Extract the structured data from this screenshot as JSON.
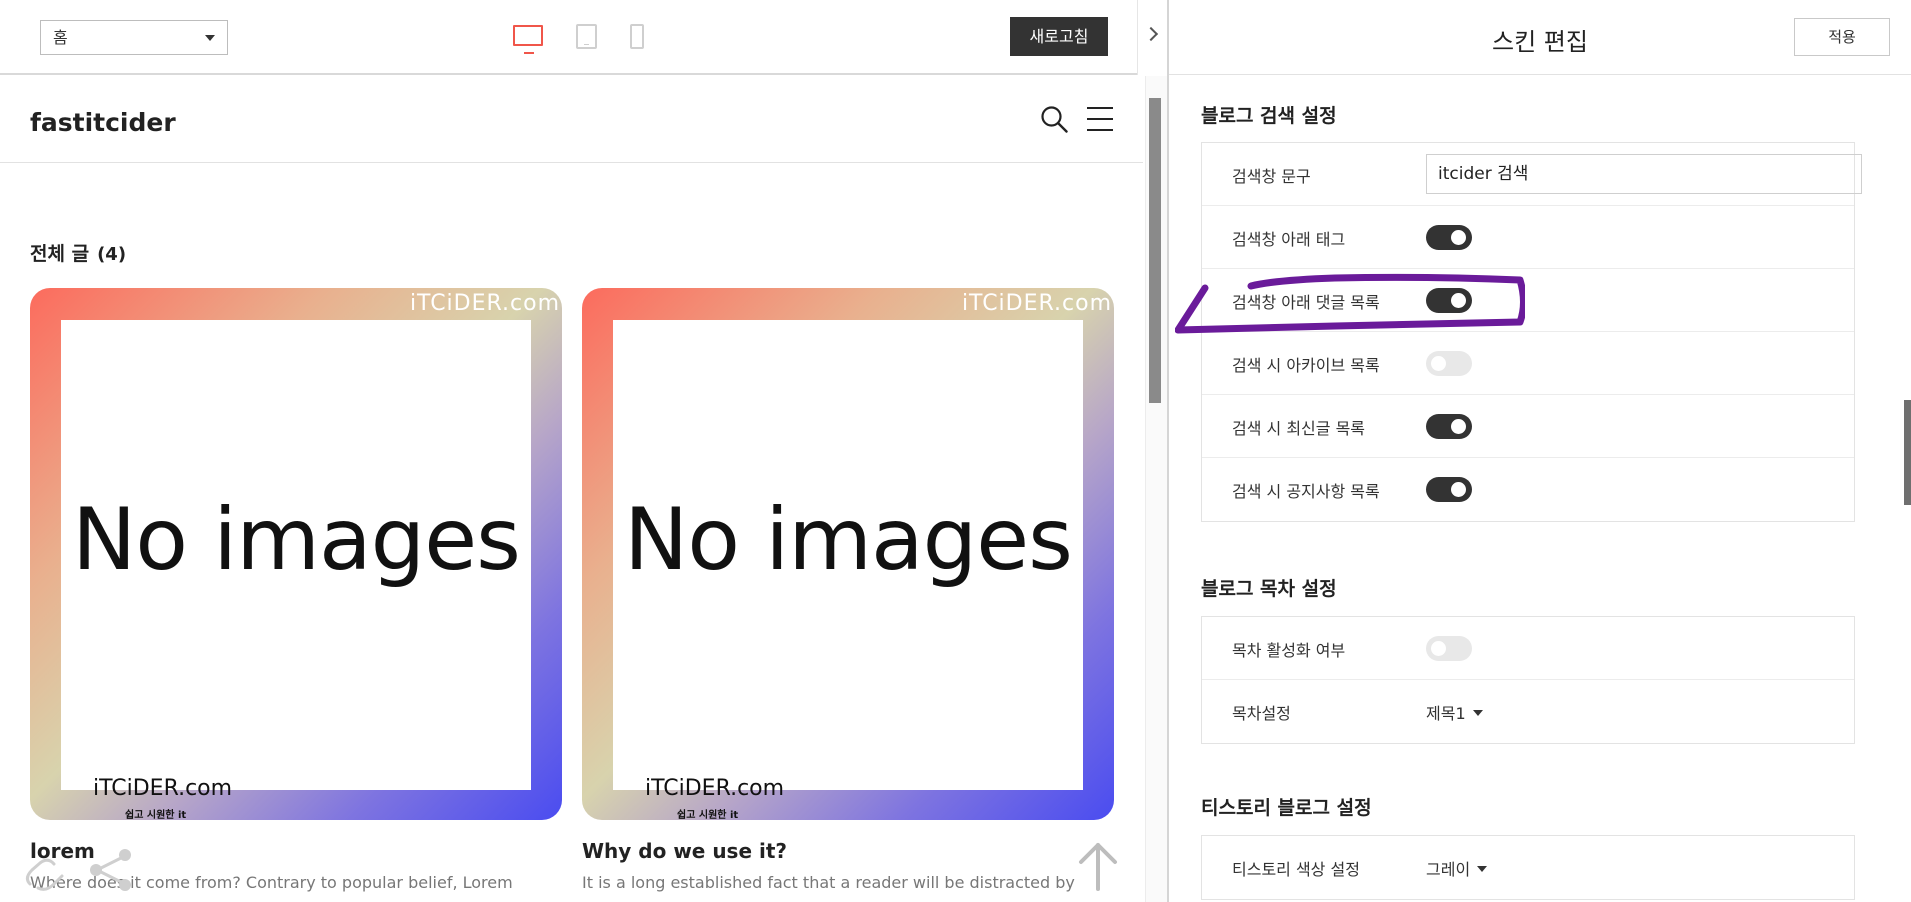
{
  "toolbar": {
    "page_select": "홈",
    "refresh_label": "새로고침"
  },
  "blog": {
    "title": "fastitcider",
    "section_title": "전체 글",
    "section_count": "(4)",
    "posts": [
      {
        "title": "lorem",
        "excerpt": "Where does it come from? Contrary to popular belief, Lorem",
        "image_text": "No images",
        "watermark_top": "iTCiDER.com",
        "watermark_logo": "iTCiDER.com",
        "watermark_sub": "쉽고 시원한 it"
      },
      {
        "title": "Why do we use it?",
        "excerpt": "It is a long established fact that a reader will be distracted by",
        "image_text": "No images",
        "watermark_top": "iTCiDER.com",
        "watermark_logo": "iTCiDER.com",
        "watermark_sub": "쉽고 시원한 it"
      }
    ]
  },
  "editor": {
    "title": "스킨 편집",
    "apply_label": "적용",
    "groups": [
      {
        "title": "블로그 검색 설정",
        "rows": [
          {
            "label": "검색창 문구",
            "type": "input",
            "value": "itcider 검색"
          },
          {
            "label": "검색창 아래 태그",
            "type": "toggle",
            "on": true
          },
          {
            "label": "검색창 아래 댓글 목록",
            "type": "toggle",
            "on": true
          },
          {
            "label": "검색 시 아카이브 목록",
            "type": "toggle",
            "on": false
          },
          {
            "label": "검색 시 최신글 목록",
            "type": "toggle",
            "on": true
          },
          {
            "label": "검색 시 공지사항 목록",
            "type": "toggle",
            "on": true
          }
        ]
      },
      {
        "title": "블로그 목차 설정",
        "rows": [
          {
            "label": "목차 활성화 여부",
            "type": "toggle",
            "on": false
          },
          {
            "label": "목차설정",
            "type": "dropdown",
            "value": "제목1"
          }
        ]
      },
      {
        "title": "티스토리 블로그 설정",
        "rows": [
          {
            "label": "티스토리 색상 설정",
            "type": "dropdown",
            "value": "그레이"
          }
        ]
      }
    ]
  },
  "colors": {
    "accent_device": "#f0564a",
    "toggle_on": "#333333",
    "toggle_off": "#e8e8e8",
    "annotation": "#6a1b9a"
  },
  "icons": {
    "desktop": "desktop-icon",
    "tablet": "tablet-icon",
    "mobile": "mobile-icon",
    "search": "search-icon",
    "menu": "hamburger-menu-icon",
    "share": "share-icon",
    "link": "link-icon",
    "scroll_top": "arrow-up-icon",
    "collapse": "chevron-right-icon"
  }
}
